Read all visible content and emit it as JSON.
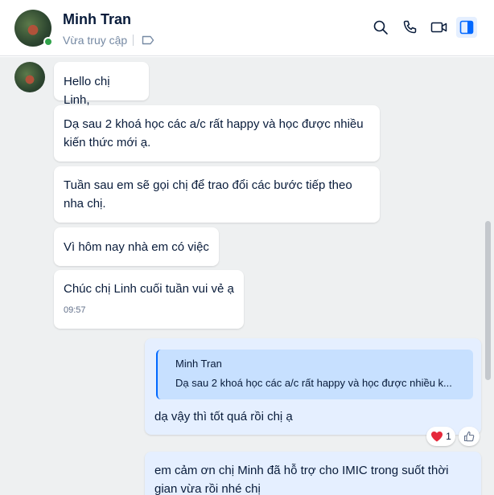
{
  "contact": {
    "name": "Minh Tran",
    "status": "Vừa truy cập"
  },
  "header_actions": [
    {
      "name": "search-icon"
    },
    {
      "name": "phone-icon"
    },
    {
      "name": "video-icon"
    },
    {
      "name": "sidebar-toggle-icon"
    }
  ],
  "messages": [
    {
      "text": "Hello chị Linh,"
    },
    {
      "text": "Dạ sau 2 khoá học các a/c rất happy và học được nhiều kiến thức mới ạ."
    },
    {
      "text": "Tuần sau em sẽ gọi chị để trao đổi các bước tiếp theo nha chị."
    },
    {
      "text": "Vì hôm nay nhà em có việc"
    },
    {
      "text": "Chúc chị Linh cuối tuần vui vẻ ạ",
      "time": "09:57"
    }
  ],
  "reply": {
    "quote_name": "Minh Tran",
    "quote_text": "Dạ sau 2 khoá học các a/c rất happy và học được nhiều k...",
    "text": "dạ vậy thì tốt quá rồi chị ạ",
    "reaction_count": "1"
  },
  "last_message": {
    "text": "em cảm ơn chị Minh đã hỗ trợ cho IMIC trong suốt thời gian vừa rồi nhé chị"
  }
}
